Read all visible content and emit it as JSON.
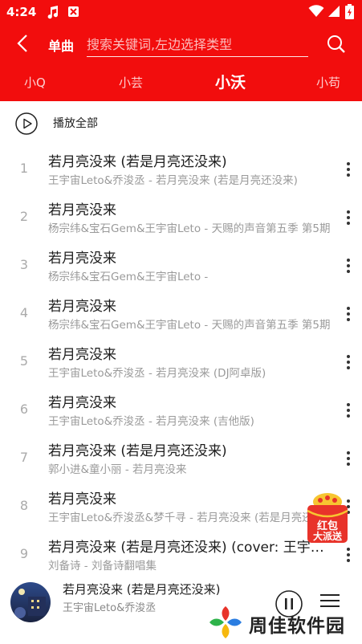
{
  "status_bar": {
    "time": "4:24",
    "icons": [
      "music-note-icon",
      "app-notification-icon",
      "wifi-icon",
      "signal-icon",
      "battery-icon"
    ]
  },
  "header": {
    "mode_label": "单曲",
    "search_placeholder": "搜索关键词,左边选择类型"
  },
  "tabs": [
    {
      "label": "小Q",
      "active": false
    },
    {
      "label": "小芸",
      "active": false
    },
    {
      "label": "小沃",
      "active": true
    },
    {
      "label": "小苟",
      "active": false
    }
  ],
  "play_all": {
    "label": "播放全部"
  },
  "songs": [
    {
      "index": "1",
      "title": "若月亮没来 (若是月亮还没来)",
      "subtitle": "王宇宙Leto&乔浚丞 - 若月亮没来 (若是月亮还没来)"
    },
    {
      "index": "2",
      "title": "若月亮没来",
      "subtitle": "杨宗纬&宝石Gem&王宇宙Leto - 天赐的声音第五季 第5期"
    },
    {
      "index": "3",
      "title": "若月亮没来",
      "subtitle": "杨宗纬&宝石Gem&王宇宙Leto -"
    },
    {
      "index": "4",
      "title": "若月亮没来",
      "subtitle": "杨宗纬&宝石Gem&王宇宙Leto - 天赐的声音第五季 第5期"
    },
    {
      "index": "5",
      "title": "若月亮没来",
      "subtitle": "王宇宙Leto&乔浚丞 - 若月亮没来 (DJ阿卓版)"
    },
    {
      "index": "6",
      "title": "若月亮没来",
      "subtitle": "王宇宙Leto&乔浚丞 - 若月亮没来 (吉他版)"
    },
    {
      "index": "7",
      "title": "若月亮没来 (若是月亮还没来)",
      "subtitle": "郭小进&童小丽 - 若月亮没来"
    },
    {
      "index": "8",
      "title": "若月亮没来",
      "subtitle": "王宇宙Leto&乔浚丞&梦千寻 - 若月亮没来 (若是月亮还没来)"
    },
    {
      "index": "9",
      "title": "若月亮没来 (若是月亮还没来) (cover: 王宇宙Leto)",
      "subtitle": "刘备诗 - 刘备诗翻唱集"
    }
  ],
  "player": {
    "title": "若月亮没来 (若是月亮还没来)",
    "artist": "王宇宙Leto&乔浚丞"
  },
  "red_packet": {
    "line1": "红包",
    "line2": "大派送"
  },
  "watermark": {
    "text": "周佳软件园"
  },
  "colors": {
    "accent": "#f20d0d",
    "text_primary": "#1c1c1c",
    "text_secondary": "#9a9a9a"
  }
}
